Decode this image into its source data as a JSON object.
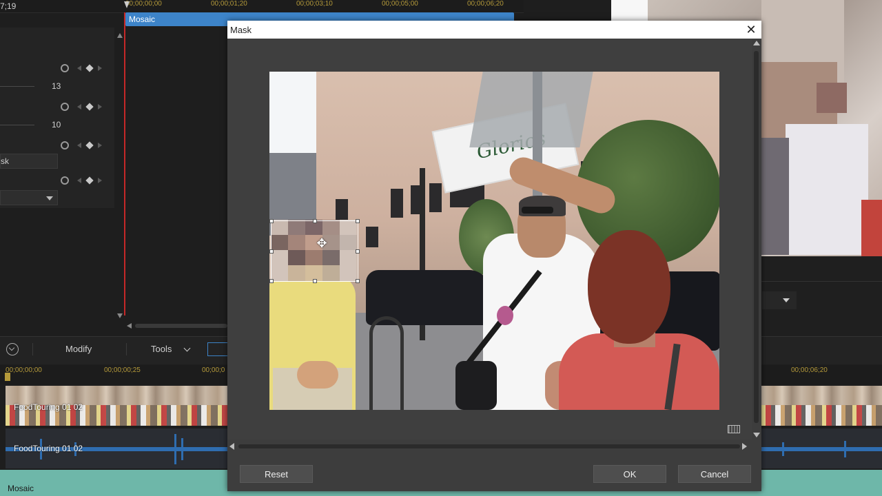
{
  "editor": {
    "timecode_left": "7;19",
    "ruler_ticks": [
      "00;00;00;00",
      "00;00;01;20",
      "00;00;03;10",
      "00;00;05;00",
      "00;00;06;20"
    ],
    "effect_clip_label": "Mosaic",
    "properties": {
      "value_1": "13",
      "value_2": "10",
      "mask_field": "sk"
    },
    "toolbar": {
      "modify_label": "Modify",
      "tools_label": "Tools"
    },
    "timeline_ticks": [
      "00;00;00;00",
      "00;00;00;25",
      "00;00;0",
      "00;00;06;20"
    ],
    "tracks": {
      "video_label": "FoodTouring 01 02",
      "audio_label": "FoodTouring 01 02",
      "effect_label": "Mosaic"
    },
    "colors": {
      "effect_clip": "#3d84c9",
      "playhead": "#c62828",
      "mosaic_track": "#6eb7a9",
      "audio_wave": "#2f6db0"
    }
  },
  "mask_dialog": {
    "title": "Mask",
    "close_glyph": "✕",
    "move_glyph": "✥",
    "reset_label": "Reset",
    "ok_label": "OK",
    "cancel_label": "Cancel"
  },
  "photo": {
    "banner_text": "Glorios"
  },
  "icons": [
    "close-icon",
    "move-icon",
    "stopwatch-icon",
    "keyframe-diamond-icon",
    "chevron-down-icon",
    "fit-view-icon"
  ]
}
